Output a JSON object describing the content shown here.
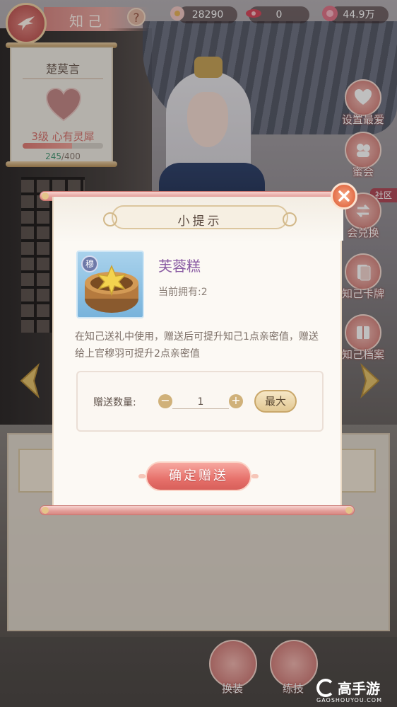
{
  "header": {
    "title": "知己",
    "help_symbol": "?",
    "back_icon": "swallow-back-icon"
  },
  "currencies": [
    {
      "icon": "camellia-flower-icon",
      "value": "28290"
    },
    {
      "icon": "red-ribbon-icon",
      "value": "0"
    },
    {
      "icon": "peony-flower-icon",
      "value": "44.9万"
    }
  ],
  "companion": {
    "name": "楚莫言",
    "level_text": "3级 心有灵犀",
    "intimacy_current": "245",
    "intimacy_max": "/400",
    "intimacy_fraction": 0.6125
  },
  "side_menu": {
    "items": [
      {
        "label": "设置最爱",
        "icon": "heart-icon"
      },
      {
        "label": "蜜会",
        "icon": "couple-icon"
      },
      {
        "label": "会兑换",
        "icon": "exchange-icon"
      },
      {
        "label": "知己卡牌",
        "icon": "card-icon"
      },
      {
        "label": "知己档案",
        "icon": "book-icon"
      }
    ],
    "community_label": "社区"
  },
  "bottom_bar": {
    "items": [
      {
        "label": "换装",
        "icon": "robe-icon"
      },
      {
        "label": "练技",
        "icon": "scroll-icon"
      }
    ]
  },
  "modal": {
    "title": "小提示",
    "item": {
      "name": "芙蓉糕",
      "badge": "穆",
      "owned_text": "当前拥有:2",
      "description": "在知己送礼中使用，赠送后可提升知己1点亲密值，赠送给上官穆羽可提升2点亲密值",
      "icon": "lotus-cake-icon"
    },
    "quantity": {
      "label": "赠送数量:",
      "value": "1",
      "minus_symbol": "−",
      "plus_symbol": "+",
      "max_label": "最大"
    },
    "confirm_label": "确定赠送"
  },
  "watermark": {
    "text": "高手游",
    "url": "GAOSHOUYOU.COM"
  },
  "colors": {
    "accent_pink": "#e7716b",
    "item_name_purple": "#8a5ca3",
    "level_text": "#d7746f",
    "intimacy_green": "#4a9a78"
  }
}
